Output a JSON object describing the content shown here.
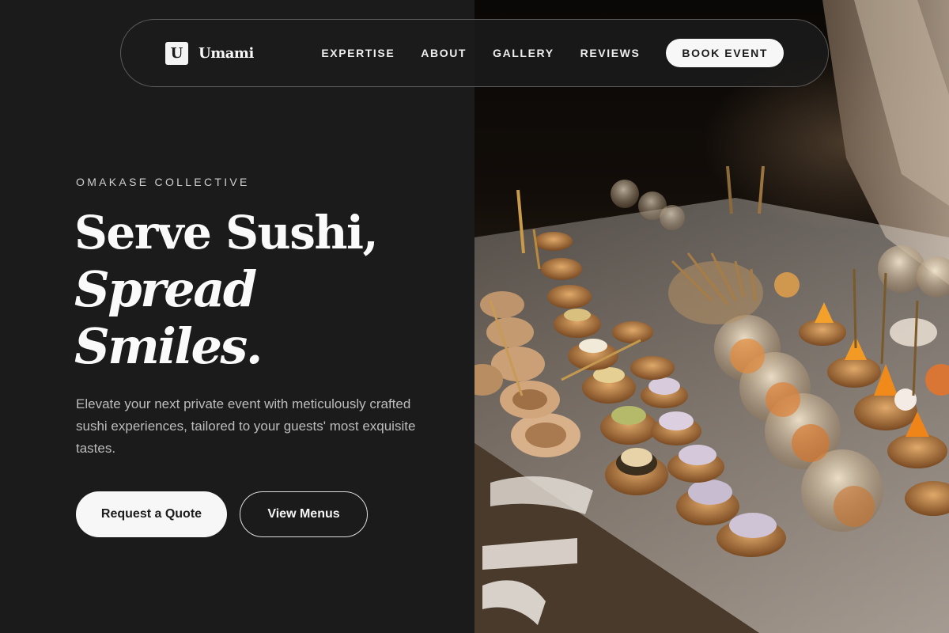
{
  "nav": {
    "brand_mark": "U",
    "brand_name": "Umami",
    "links": [
      "EXPERTISE",
      "ABOUT",
      "GALLERY",
      "REVIEWS"
    ],
    "cta_label": "BOOK EVENT"
  },
  "hero": {
    "eyebrow": "OMAKASE COLLECTIVE",
    "headline_line1": "Serve Sushi,",
    "headline_line2": "Spread",
    "headline_line3": "Smiles.",
    "description": "Elevate your next private event with meticulously crafted sushi experiences, tailored to your guests' most exquisite tastes.",
    "primary_button": "Request a Quote",
    "secondary_button": "View Menus"
  },
  "colors": {
    "background": "#1b1b1b",
    "text": "#fafafa",
    "muted_text": "#bcbcbc",
    "button_light": "#f7f7f7"
  }
}
